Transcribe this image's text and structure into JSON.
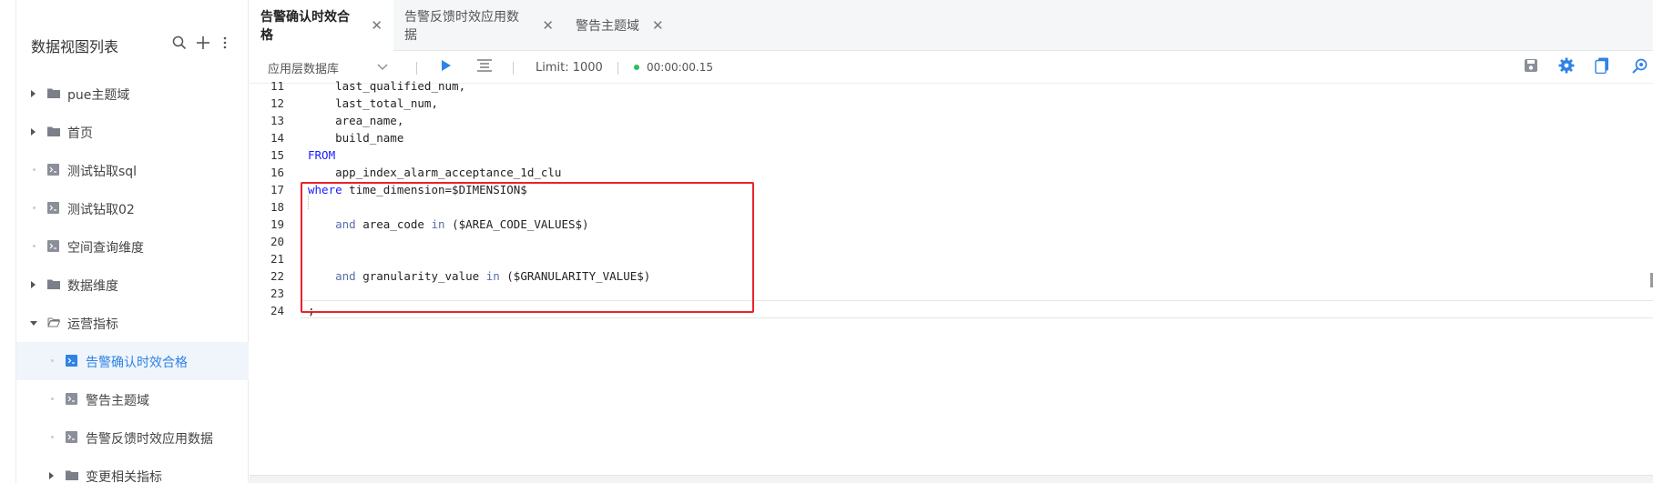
{
  "sidebar": {
    "title": "数据视图列表",
    "items": [
      {
        "label": "pue主题域",
        "kind": "folder",
        "state": "collapsed",
        "level": 0
      },
      {
        "label": "首页",
        "kind": "folder",
        "state": "collapsed",
        "level": 0
      },
      {
        "label": "测试钻取sql",
        "kind": "sql",
        "level": 0
      },
      {
        "label": "测试钻取02",
        "kind": "sql",
        "level": 0
      },
      {
        "label": "空间查询维度",
        "kind": "sql",
        "level": 0
      },
      {
        "label": "数据维度",
        "kind": "folder",
        "state": "collapsed",
        "level": 0
      },
      {
        "label": "运营指标",
        "kind": "folder",
        "state": "expanded",
        "level": 0
      },
      {
        "label": "告警确认时效合格",
        "kind": "sql",
        "level": 1,
        "active": true
      },
      {
        "label": "警告主题域",
        "kind": "sql",
        "level": 1
      },
      {
        "label": "告警反馈时效应用数据",
        "kind": "sql",
        "level": 1
      },
      {
        "label": "变更相关指标",
        "kind": "folder",
        "state": "collapsed",
        "level": 1
      }
    ]
  },
  "tabs": [
    {
      "label": "告警确认时效合格",
      "active": true
    },
    {
      "label": "告警反馈时效应用数据",
      "active": false
    },
    {
      "label": "警告主题域",
      "active": false
    }
  ],
  "toolbar": {
    "datasource": "应用层数据库",
    "limit": "Limit: 1000",
    "elapsed": "00:00:00.15"
  },
  "editor": {
    "lines": [
      {
        "n": "11",
        "code": "    last_qualified_num,"
      },
      {
        "n": "12",
        "code": "    last_total_num,"
      },
      {
        "n": "13",
        "code": "    area_name,"
      },
      {
        "n": "14",
        "code": "    build_name"
      },
      {
        "n": "15",
        "kw": "FROM",
        "code": ""
      },
      {
        "n": "16",
        "code": "    app_index_alarm_acceptance_1d_clu"
      },
      {
        "n": "17",
        "kw": "where",
        "code": " time_dimension=$DIMENSION$"
      },
      {
        "n": "18",
        "code": ""
      },
      {
        "n": "19",
        "pre": "    ",
        "op": "and",
        "mid": " area_code ",
        "op2": "in",
        "code": " ($AREA_CODE_VALUES$)"
      },
      {
        "n": "20",
        "code": ""
      },
      {
        "n": "21",
        "code": ""
      },
      {
        "n": "22",
        "pre": "    ",
        "op": "and",
        "mid": " granularity_value ",
        "op2": "in",
        "code": " ($GRANULARITY_VALUE$)"
      },
      {
        "n": "23",
        "code": ""
      },
      {
        "n": "24",
        "code": ";"
      }
    ]
  },
  "colors": {
    "accent": "#2f83e6",
    "keyword": "#1a1aff",
    "highlight_border": "#e8232a",
    "status_dot": "#2ebd59"
  }
}
